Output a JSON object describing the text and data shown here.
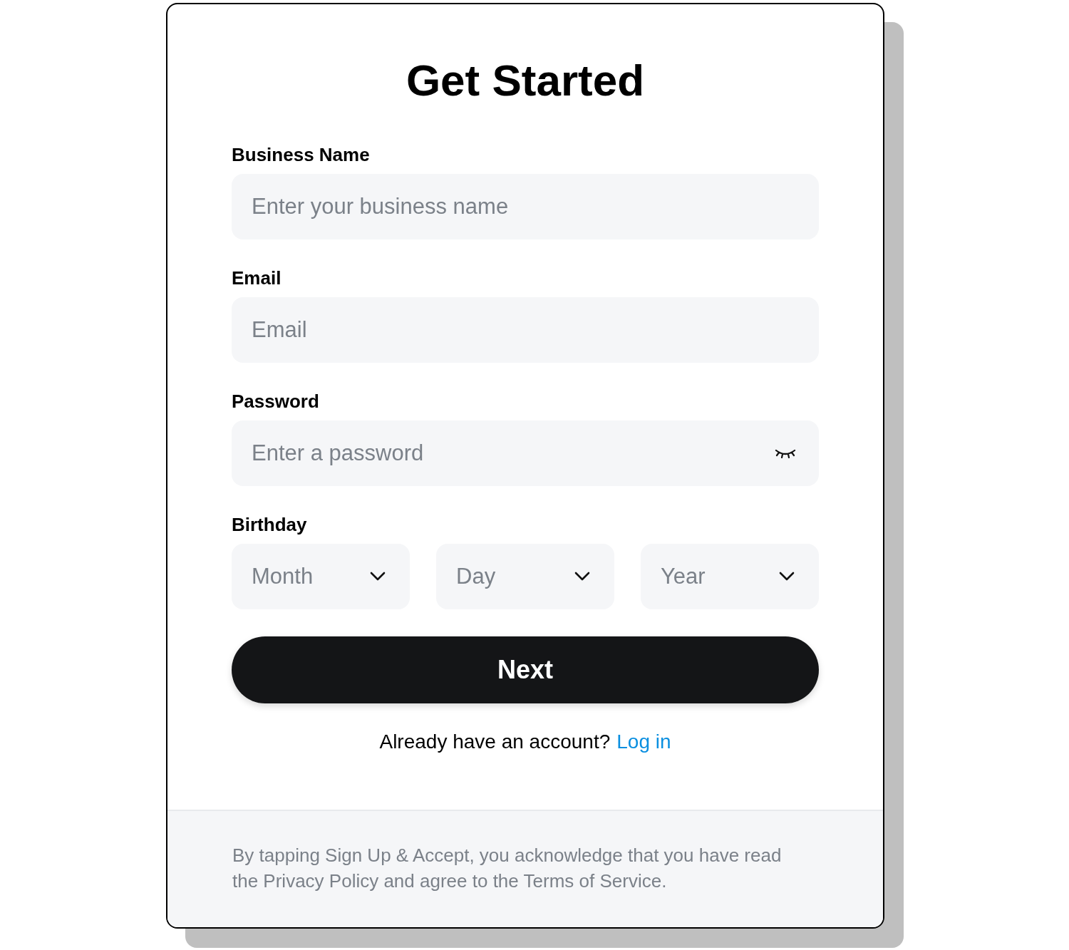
{
  "title": "Get Started",
  "fields": [
    {
      "label": "Business Name",
      "placeholder": "Enter your business name",
      "kind": "text"
    },
    {
      "label": "Email",
      "placeholder": "Email",
      "kind": "text"
    },
    {
      "label": "Password",
      "placeholder": "Enter a password",
      "kind": "password"
    }
  ],
  "birthday": {
    "label": "Birthday",
    "selects": [
      {
        "placeholder": "Month"
      },
      {
        "placeholder": "Day"
      },
      {
        "placeholder": "Year"
      }
    ]
  },
  "button": "Next",
  "login": {
    "text": "Already have an account?",
    "link": "Log in"
  },
  "footer": "By tapping Sign Up & Accept, you acknowledge that you have read the Privacy Policy and agree to the Terms of Service."
}
